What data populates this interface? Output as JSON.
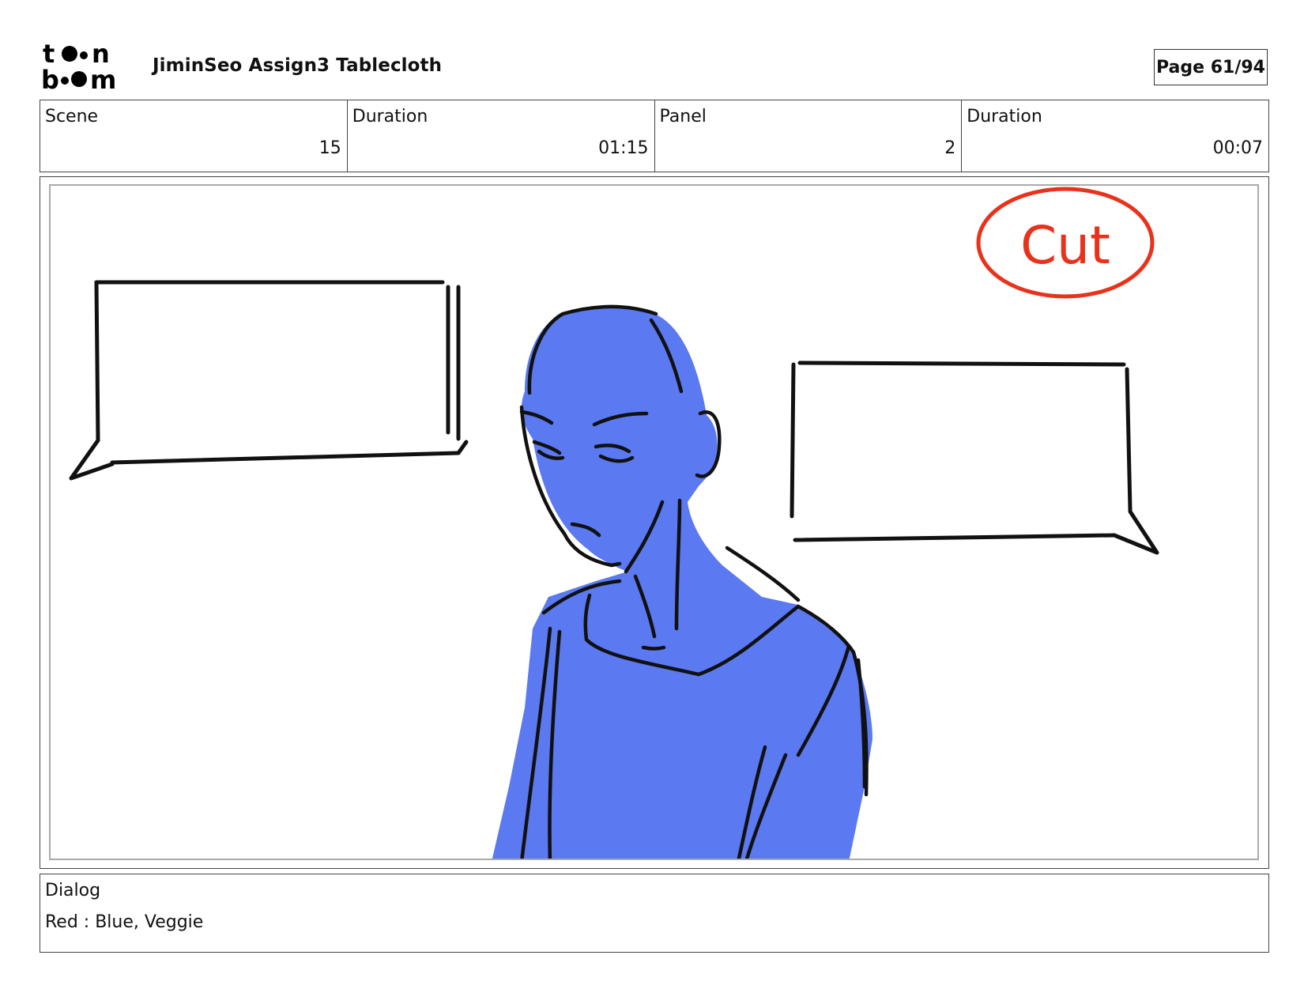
{
  "header": {
    "logo": {
      "brand": "toon boom",
      "icon": "toon-boom-logo"
    },
    "title": "JiminSeo Assign3 Tablecloth",
    "page_label": "Page 61/94"
  },
  "info": [
    {
      "label": "Scene",
      "value": "15"
    },
    {
      "label": "Duration",
      "value": "01:15"
    },
    {
      "label": "Panel",
      "value": "2"
    },
    {
      "label": "Duration",
      "value": "00:07"
    }
  ],
  "panel": {
    "annotation": "Cut",
    "annotation_color": "#e8321c",
    "figure_color": "#5b79f0"
  },
  "dialog": {
    "label": "Dialog",
    "text": "Red : Blue, Veggie"
  }
}
